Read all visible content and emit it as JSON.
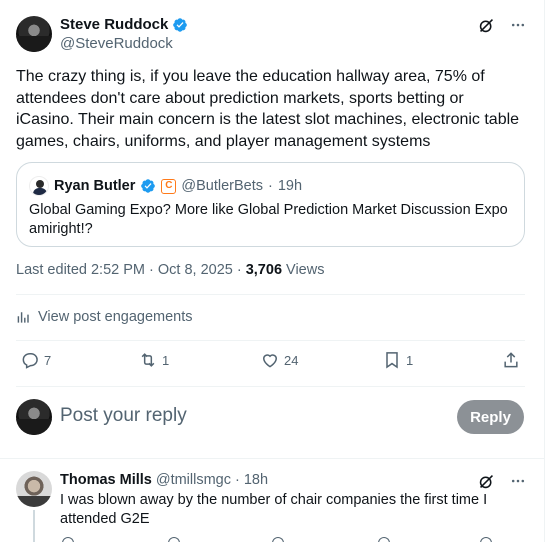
{
  "post": {
    "author_name": "Steve Ruddock",
    "author_handle": "@SteveRuddock",
    "text": "The crazy thing is, if you leave the education hallway area, 75% of attendees don't care about prediction markets, sports betting or iCasino. Their main concern is the latest slot machines, electronic table games, chairs, uniforms, and player management systems",
    "quote": {
      "author_name": "Ryan Butler",
      "author_handle": "@ButlerBets",
      "separator": "·",
      "time": "19h",
      "org_badge": "C",
      "text": "Global Gaming Expo? More like Global Prediction Market Discussion Expo amiright!?"
    },
    "meta": {
      "edited": "Last edited 2:52 PM · Oct 8, 2025 ·",
      "views_count": "3,706",
      "views_label": "Views"
    },
    "engagements_label": "View post engagements",
    "actions": {
      "replies": "7",
      "reposts": "1",
      "likes": "24",
      "bookmarks": "1"
    }
  },
  "composer": {
    "placeholder": "Post your reply",
    "button_label": "Reply"
  },
  "comment": {
    "author_name": "Thomas Mills",
    "author_handle": "@tmillsmgc",
    "separator": "·",
    "time": "18h",
    "text": "I was blown away by the number of chair companies the first time I attended G2E"
  },
  "icons": [
    "verified-badge-icon",
    "grok-icon",
    "more-icon",
    "analytics-icon",
    "reply-icon",
    "repost-icon",
    "like-icon",
    "bookmark-icon",
    "share-icon"
  ],
  "colors": {
    "verified": "#1d9bf0",
    "secondary_text": "#536471",
    "reply_button": "#8c9196",
    "border": "#cfd9de"
  }
}
